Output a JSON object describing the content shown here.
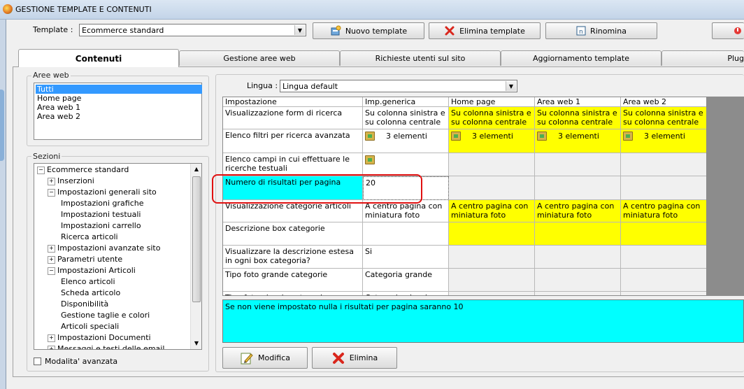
{
  "window": {
    "title": "GESTIONE TEMPLATE E CONTENUTI"
  },
  "toolbar": {
    "template_label": "Template :",
    "template_value": "Ecommerce standard",
    "new_template": "Nuovo template",
    "delete_template": "Elimina template",
    "rename": "Rinomina"
  },
  "tabs": [
    {
      "label": "Contenuti"
    },
    {
      "label": "Gestione aree web"
    },
    {
      "label": "Richieste utenti sul sito"
    },
    {
      "label": "Aggiornamento template"
    },
    {
      "label": "Plug"
    }
  ],
  "aree_web": {
    "label": "Aree web",
    "items": [
      "Tutti",
      "Home page",
      "Area web 1",
      "Area web 2"
    ],
    "selected": "Tutti"
  },
  "sezioni": {
    "label": "Sezioni",
    "items": [
      {
        "label": "Ecommerce standard",
        "toggle": "⊟"
      },
      {
        "label": "Inserzioni",
        "toggle": "⊞"
      },
      {
        "label": "Impostazioni generali sito",
        "toggle": "⊟"
      },
      {
        "label": "Impostazioni grafiche",
        "toggle": ""
      },
      {
        "label": "Impostazioni testuali",
        "toggle": ""
      },
      {
        "label": "Impostazioni carrello",
        "toggle": ""
      },
      {
        "label": "Ricerca articoli",
        "toggle": ""
      },
      {
        "label": "Impostazioni avanzate sito",
        "toggle": "⊞"
      },
      {
        "label": "Parametri utente",
        "toggle": "⊞"
      },
      {
        "label": "Impostazioni Articoli",
        "toggle": "⊟"
      },
      {
        "label": "Elenco articoli",
        "toggle": ""
      },
      {
        "label": "Scheda articolo",
        "toggle": ""
      },
      {
        "label": "Disponibilità",
        "toggle": ""
      },
      {
        "label": "Gestione taglie e colori",
        "toggle": ""
      },
      {
        "label": "Articoli speciali",
        "toggle": ""
      },
      {
        "label": "Impostazioni Documenti",
        "toggle": "⊞"
      },
      {
        "label": "Messaggi e testi delle email",
        "toggle": "⊞"
      }
    ]
  },
  "advanced_mode": {
    "label": "Modalita' avanzata",
    "checked": false
  },
  "lingua": {
    "label": "Lingua :",
    "value": "Lingua default"
  },
  "grid": {
    "headers": [
      "Impostazione",
      "Imp.generica",
      "Home page",
      "Area web 1",
      "Area web 2"
    ],
    "rows": [
      [
        "Visualizzazione form di ricerca",
        "Su colonna sinistra e su colonna centrale",
        "Su colonna sinistra e su colonna centrale",
        "Su colonna sinistra e su colonna centrale",
        "Su colonna sinistra e su colonna centrale"
      ],
      [
        "Elenco filtri per ricerca avanzata",
        "3 elementi",
        "3 elementi",
        "3 elementi",
        "3 elementi"
      ],
      [
        "Elenco campi in cui effettuare le ricerche testuali",
        "",
        "",
        "",
        ""
      ],
      [
        "Numero di risultati per pagina",
        "20",
        "",
        "",
        ""
      ],
      [
        "Visualizzazione categorie articoli",
        "A centro pagina con miniatura foto",
        "A centro pagina con miniatura foto",
        "A centro pagina con miniatura foto",
        "A centro pagina con miniatura foto"
      ],
      [
        "Descrizione box categorie",
        "",
        "",
        "",
        ""
      ],
      [
        "Visualizzare la descrizione estesa in ogni box categoria?",
        "Si",
        "",
        "",
        ""
      ],
      [
        "Tipo foto grande categorie",
        "Categoria grande",
        "",
        "",
        ""
      ],
      [
        "Tipo foto piccola categorie",
        "Categoria piccola",
        "",
        "",
        ""
      ]
    ]
  },
  "description": "Se non viene impostato nulla i risultati per pagina saranno 10",
  "actions": {
    "edit": "Modifica",
    "delete": "Elimina"
  },
  "colors": {
    "yellow": "#ffff00",
    "cyan": "#00ffff",
    "selection": "#3399ff",
    "highlight": "#e01010"
  }
}
